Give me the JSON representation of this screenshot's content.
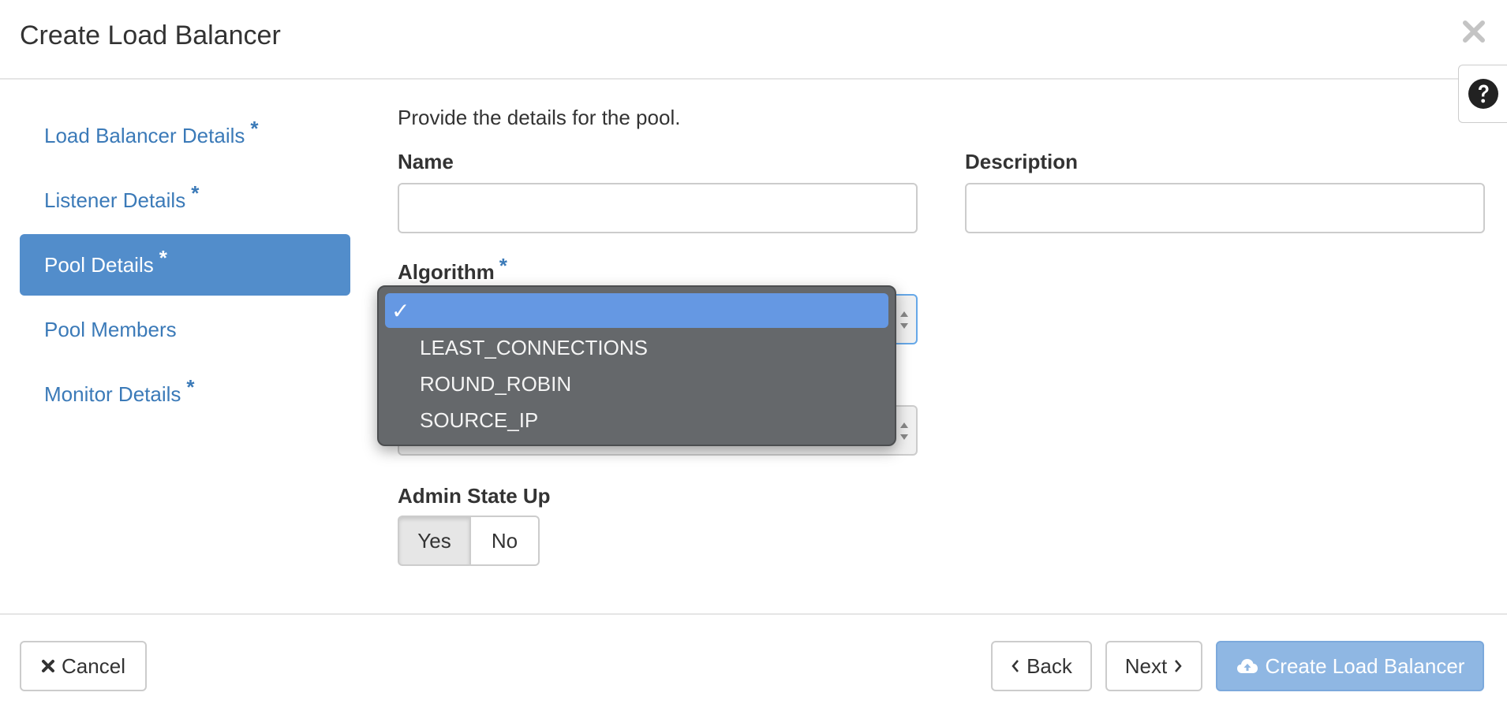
{
  "modal": {
    "title": "Create Load Balancer",
    "close_icon": "close-icon",
    "help_icon": "question-circle-icon"
  },
  "sidebar": {
    "items": [
      {
        "label": "Load Balancer Details",
        "required": true,
        "active": false
      },
      {
        "label": "Listener Details",
        "required": true,
        "active": false
      },
      {
        "label": "Pool Details",
        "required": true,
        "active": true
      },
      {
        "label": "Pool Members",
        "required": false,
        "active": false
      },
      {
        "label": "Monitor Details",
        "required": true,
        "active": false
      }
    ],
    "required_marker": "*"
  },
  "form": {
    "intro": "Provide the details for the pool.",
    "name_label": "Name",
    "name_value": "",
    "description_label": "Description",
    "description_value": "",
    "algorithm_label": "Algorithm",
    "algorithm_required": "*",
    "admin_state_label": "Admin State Up",
    "admin_state_yes": "Yes",
    "admin_state_no": "No",
    "admin_state_value": "Yes"
  },
  "dropdown": {
    "check": "✓",
    "options": [
      "",
      "LEAST_CONNECTIONS",
      "ROUND_ROBIN",
      "SOURCE_IP"
    ],
    "selected_index": 0
  },
  "footer": {
    "cancel_label": "Cancel",
    "back_label": "Back",
    "next_label": "Next",
    "create_label": "Create Load Balancer"
  },
  "colors": {
    "link": "#3b7ab8",
    "active_nav": "#528dcb",
    "primary_disabled": "#8fb7e3",
    "dropdown_bg": "#65686b",
    "dropdown_selected": "#6598e3"
  }
}
